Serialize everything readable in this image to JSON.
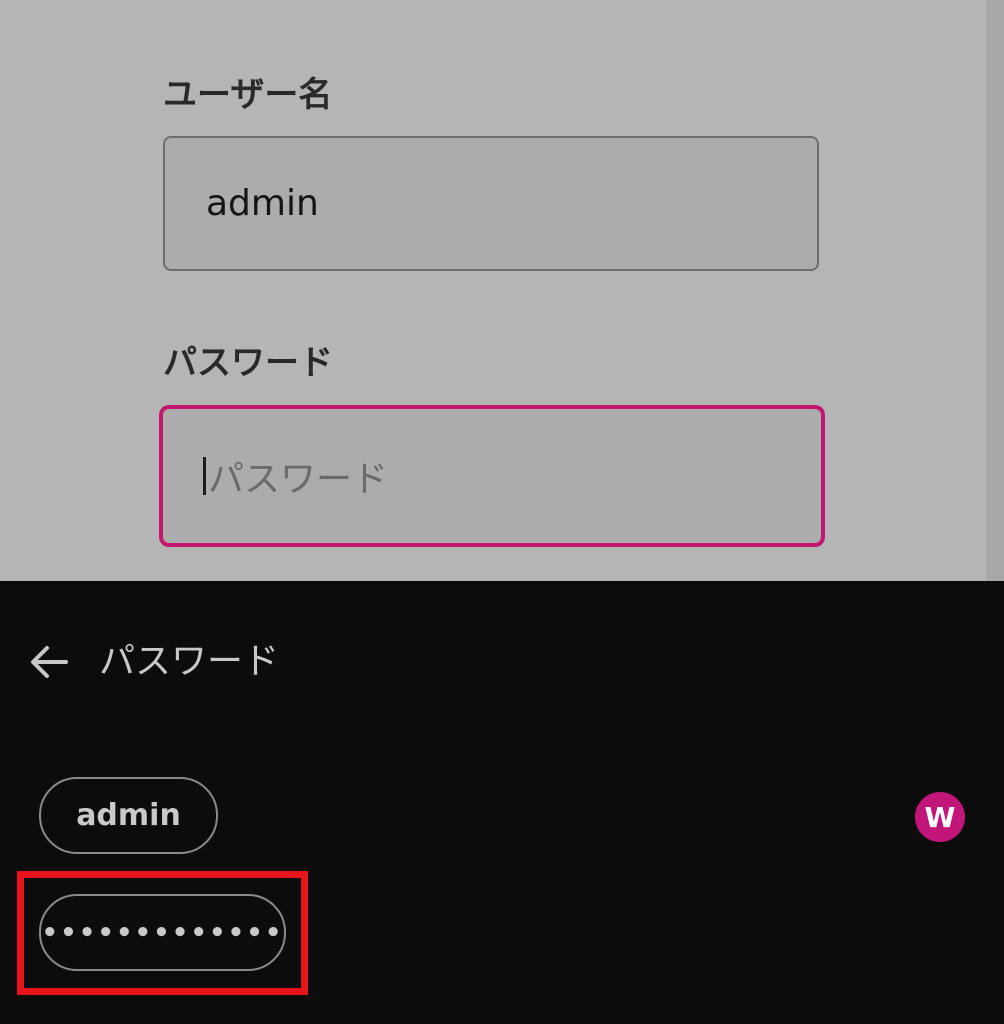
{
  "form": {
    "username_label": "ユーザー名",
    "username_value": "admin",
    "password_label": "パスワード",
    "password_placeholder": "パスワード"
  },
  "autofill_sheet": {
    "title": "パスワード",
    "back_icon": "arrow-left-icon",
    "suggestions": [
      {
        "label": "admin"
      },
      {
        "label": "•••••••••••••"
      }
    ],
    "account_avatar_letter": "W"
  },
  "colors": {
    "accent": "#c2166f",
    "avatar": "#c2157a",
    "highlight": "#e8141b",
    "sheet_background": "#0c0c0c",
    "form_background": "#b5b5b5"
  }
}
